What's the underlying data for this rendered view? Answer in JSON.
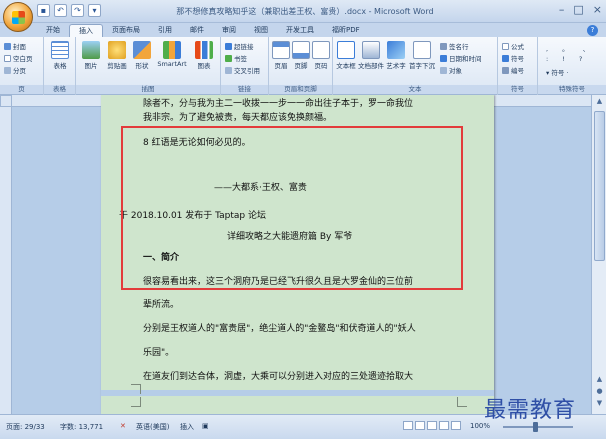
{
  "window": {
    "title": "那不想修真攻略知乎这（兼职出差王权、富贵）.docx - Microsoft Word",
    "controls": [
      "–",
      "□",
      "×"
    ]
  },
  "tabs": [
    "开始",
    "插入",
    "页面布局",
    "引用",
    "邮件",
    "审阅",
    "视图",
    "开发工具",
    "福昕PDF"
  ],
  "active_tab": "插入",
  "ribbon": {
    "groups": [
      {
        "label": "页",
        "items": [
          "封面",
          "空白页",
          "分页"
        ]
      },
      {
        "label": "表格",
        "items": [
          "表格"
        ]
      },
      {
        "label": "插图",
        "items": [
          "图片",
          "剪贴画",
          "形状",
          "SmartArt",
          "图表"
        ]
      },
      {
        "label": "链接",
        "items": [
          "超链接",
          "书签",
          "交叉引用"
        ]
      },
      {
        "label": "页眉和页脚",
        "items": [
          "页眉",
          "页脚",
          "页码"
        ]
      },
      {
        "label": "文本",
        "items": [
          "文本框",
          "文档部件",
          "艺术字",
          "首字下沉",
          "签名行",
          "日期和时间",
          "对象"
        ]
      },
      {
        "label": "符号",
        "items": [
          "公式",
          "符号",
          "编号"
        ]
      },
      {
        "label": "特殊符号",
        "items": []
      }
    ]
  },
  "document": {
    "lines_top": [
      "除者不，分与我为主二一收拨一一步一一命出往子本于，罗一命我位",
      "我非宗。为了避免被贵，每天都应该免换颜福。",
      "8 红语是无论如何必见的。",
      "——大都系·王权、富贵",
      "于 2018.10.01 发布于 Taptap 论坛"
    ],
    "box_title": "详细攻略之大能遗府篇 By 军爷",
    "heading": "一、简介",
    "paragraph_lines": [
      "很容易看出来，这三个洞府乃是已经飞升很久且是大罗金仙的三位前",
      "辈所流。",
      "分别是王权道人的\"富贵居\"，绝尘道人的\"金鳌岛\"和伏奇道人的\"妖人",
      "乐园\"。",
      "在道友们到达合体，洞虚，大乘可以分别进入对应的三处遗迹拾取大"
    ]
  },
  "statusbar": {
    "page": "页面: 29/33",
    "words": "字数: 13,771",
    "language": "英语(美国)",
    "mode": "插入",
    "zoom": "100%"
  },
  "watermark": "最需教育",
  "colors": {
    "page_bg": "#cfe5cd",
    "highlight_border": "#e33b3b",
    "workspace": "#b6cde8"
  }
}
